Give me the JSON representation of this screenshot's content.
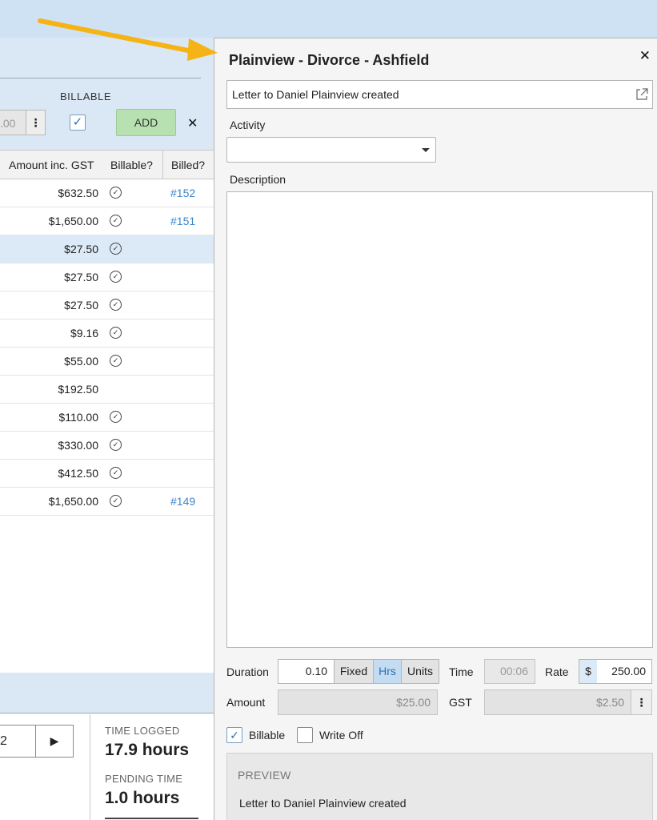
{
  "left": {
    "billable_header": "BILLABLE",
    "rate_stub_value": ".00",
    "add_label": "ADD",
    "close_label": "✕",
    "columns": [
      "Amount inc. GST",
      "Billable?",
      "Billed?"
    ],
    "rows": [
      {
        "amount": "$632.50",
        "billable": true,
        "billed": "#152"
      },
      {
        "amount": "$1,650.00",
        "billable": true,
        "billed": "#151"
      },
      {
        "amount": "$27.50",
        "billable": true,
        "billed": ""
      },
      {
        "amount": "$27.50",
        "billable": true,
        "billed": ""
      },
      {
        "amount": "$27.50",
        "billable": true,
        "billed": ""
      },
      {
        "amount": "$9.16",
        "billable": true,
        "billed": ""
      },
      {
        "amount": "$55.00",
        "billable": true,
        "billed": ""
      },
      {
        "amount": "$192.50",
        "billable": false,
        "billed": ""
      },
      {
        "amount": "$110.00",
        "billable": true,
        "billed": ""
      },
      {
        "amount": "$330.00",
        "billable": true,
        "billed": ""
      },
      {
        "amount": "$412.50",
        "billable": true,
        "billed": ""
      },
      {
        "amount": "$1,650.00",
        "billable": true,
        "billed": "#149"
      }
    ],
    "selected_row": 2,
    "pager_value": "2",
    "time_logged_label": "TIME LOGGED",
    "time_logged_value": "17.9 hours",
    "pending_time_label": "PENDING TIME",
    "pending_time_value": "1.0 hours"
  },
  "panel": {
    "title": "Plainview - Divorce - Ashfield",
    "close_label": "✕",
    "subject": "Letter to Daniel Plainview created",
    "activity_label": "Activity",
    "activity_value": "",
    "description_label": "Description",
    "description_value": "",
    "duration_label": "Duration",
    "duration_value": "0.10",
    "units": {
      "fixed": "Fixed",
      "hrs": "Hrs",
      "units": "Units",
      "active": "hrs"
    },
    "time_label": "Time",
    "time_value": "00:06",
    "rate_label": "Rate",
    "rate_currency": "$",
    "rate_value": "250.00",
    "amount_label": "Amount",
    "amount_value": "$25.00",
    "gst_label": "GST",
    "gst_value": "$2.50",
    "billable_label": "Billable",
    "billable_checked": true,
    "writeoff_label": "Write Off",
    "writeoff_checked": false,
    "preview_header": "PREVIEW",
    "preview_text": "Letter to Daniel Plainview created"
  },
  "colors": {
    "accent": "#2c6fb5",
    "link": "#3b85c9",
    "add_button": "#b7e1b1",
    "arrow": "#f5b316",
    "selected_row": "#dceaf7"
  }
}
